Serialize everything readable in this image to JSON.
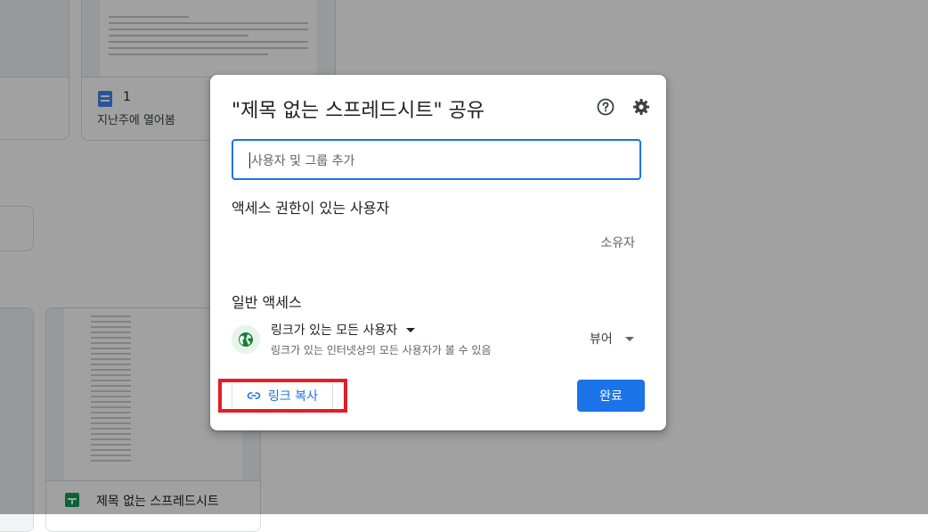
{
  "background": {
    "doc_card": {
      "name": "1",
      "subtitle": "지난주에 열어봄"
    },
    "sheet_card": {
      "name": "제목 없는 스프레드시트"
    }
  },
  "dialog": {
    "title": "\"제목 없는 스프레드시트\" 공유",
    "help_icon": "help-circle-icon",
    "settings_icon": "gear-icon",
    "add_people": {
      "placeholder": "사용자 및 그룹 추가",
      "value": ""
    },
    "access_heading": "액세스 권한이 있는 사용자",
    "owner_label": "소유자",
    "general_access_heading": "일반 액세스",
    "link_option": "링크가 있는 모든 사용자",
    "link_description": "링크가 있는 인터넷상의 모든 사용자가 볼 수 있음",
    "role": "뷰어",
    "copy_link_label": "링크 복사",
    "done_label": "완료"
  },
  "colors": {
    "accent": "#1a73e8",
    "highlight_box": "#e41e26",
    "globe": "#188038"
  }
}
